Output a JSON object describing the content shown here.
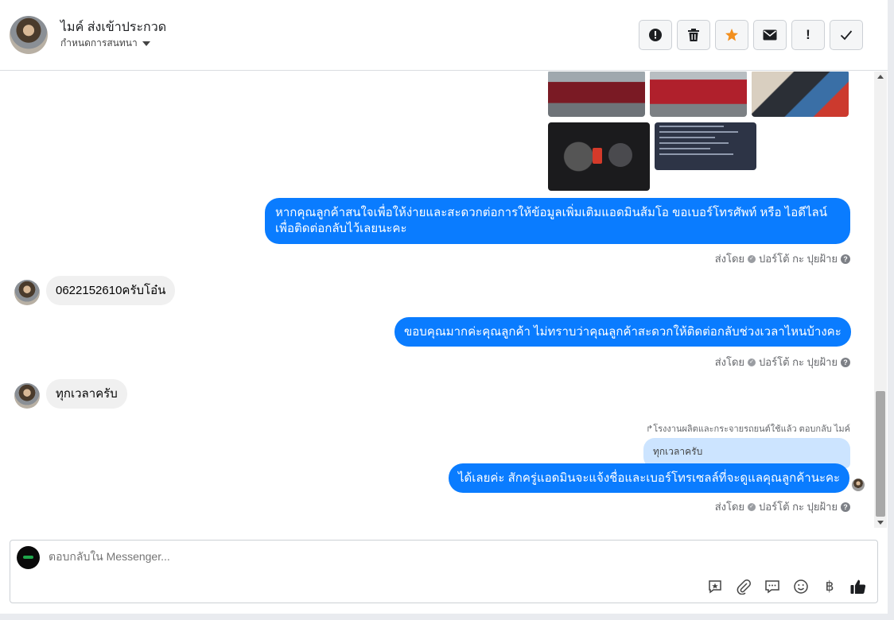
{
  "header": {
    "contact_name": "ไมค์ ส่งเข้าประกวด",
    "assign_label": "กำหนดการสนทนา"
  },
  "toolbar": {
    "buttons": [
      {
        "name": "spam-button",
        "icon": "alert-circle-icon",
        "glyph": "!"
      },
      {
        "name": "delete-button",
        "icon": "trash-icon",
        "glyph": "🗑"
      },
      {
        "name": "star-button",
        "icon": "star-icon",
        "glyph": "★"
      },
      {
        "name": "mark-unread-button",
        "icon": "envelope-icon",
        "glyph": "✉"
      },
      {
        "name": "important-button",
        "icon": "exclamation-icon",
        "glyph": "!"
      },
      {
        "name": "done-button",
        "icon": "check-icon",
        "glyph": "✓"
      }
    ],
    "star_color": "#f28f1e"
  },
  "messages": {
    "out_1_line_1": "หากคุณลูกค้าสนใจเพื่อให้ง่ายและสะดวกต่อการให้ข้อมูลเพิ่มเติมแอดมินส้มโอ ขอเบอร์โทรศัพท์ หรือ ไอดีไลน์",
    "out_1_line_2": "เพื่อติดต่อกลับไว้เลยนะคะ",
    "sent_by_1": "ส่งโดย",
    "sender_name": "ปอร์โต้ กะ ปุยฝ้าย",
    "in_1": "0622152610ครับโอ๋น",
    "out_2": "ขอบคุณมากค่ะคุณลูกค้า ไม่ทราบว่าคุณลูกค้าสะดวกให้ติดต่อกลับช่วงเวลาไหนบ้างคะ",
    "sent_by_2": "ส่งโดย",
    "in_2": "ทุกเวลาครับ",
    "reply_note": "โรงงานผลิตและกระจายรถยนต์ใช้แล้ว ตอบกลับ ไมค์",
    "quoted_text": "ทุกเวลาครับ",
    "out_3": "ได้เลยค่ะ สักครู่แอดมินจะแจ้งชื่อและเบอร์โทรเซลล์ที่จะดูแลคุณลูกค้านะคะ",
    "sent_by_3": "ส่งโดย"
  },
  "colors": {
    "outgoing_bubble": "#0a7cff",
    "incoming_bubble": "#f0f0f0",
    "quoted_bubble": "#cce4ff"
  },
  "composer": {
    "placeholder": "ตอบกลับใน Messenger...",
    "tools": [
      {
        "name": "saved-reply-button",
        "icon": "saved-reply-icon",
        "glyph": "✦"
      },
      {
        "name": "attach-button",
        "icon": "paperclip-icon",
        "glyph": "📎"
      },
      {
        "name": "quick-replies-button",
        "icon": "chat-bubble-icon",
        "glyph": "💬"
      },
      {
        "name": "emoji-button",
        "icon": "smiley-icon",
        "glyph": "☺"
      },
      {
        "name": "payment-button",
        "icon": "baht-icon",
        "glyph": "฿"
      },
      {
        "name": "like-button",
        "icon": "thumbs-up-icon",
        "glyph": "👍"
      }
    ]
  }
}
